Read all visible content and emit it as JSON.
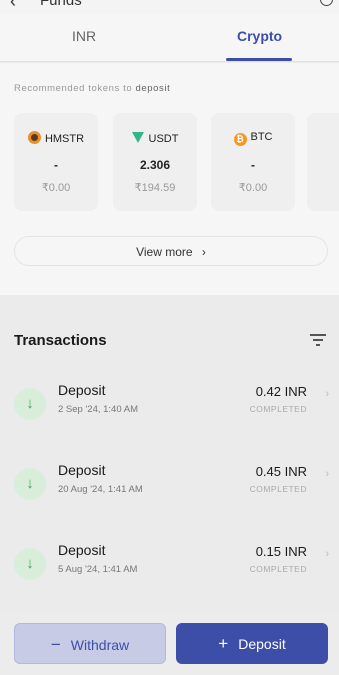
{
  "header": {
    "back_glyph": "‹",
    "title": "Funds",
    "info_icon": "info-icon"
  },
  "tabs": [
    {
      "label": "INR",
      "active": false
    },
    {
      "label": "Crypto",
      "active": true
    }
  ],
  "recommended": {
    "label_prefix": "Recommended tokens to",
    "label_emphasis": "deposit",
    "tokens": [
      {
        "symbol": "HMSTR",
        "balance": "-",
        "inr_value": "₹0.00",
        "icon": "hmstr-icon"
      },
      {
        "symbol": "USDT",
        "balance": "2.306",
        "inr_value": "₹194.59",
        "icon": "usdt-icon"
      },
      {
        "symbol": "BTC",
        "balance": "-",
        "inr_value": "₹0.00",
        "icon": "btc-icon"
      }
    ],
    "view_more_label": "View more",
    "view_more_chevron": "›"
  },
  "transactions": {
    "title": "Transactions",
    "items": [
      {
        "type": "Deposit",
        "date": "2 Sep '24, 1:40 AM",
        "amount": "0.42 INR",
        "status": "COMPLETED"
      },
      {
        "type": "Deposit",
        "date": "20 Aug '24, 1:41 AM",
        "amount": "0.45 INR",
        "status": "COMPLETED"
      },
      {
        "type": "Deposit",
        "date": "5 Aug '24, 1:41 AM",
        "amount": "0.15 INR",
        "status": "COMPLETED"
      }
    ]
  },
  "actions": {
    "withdraw_symbol": "−",
    "withdraw_label": "Withdraw",
    "deposit_symbol": "+",
    "deposit_label": "Deposit"
  },
  "colors": {
    "accent": "#3d4ea8",
    "success": "#3aa55a",
    "muted": "#999999"
  }
}
